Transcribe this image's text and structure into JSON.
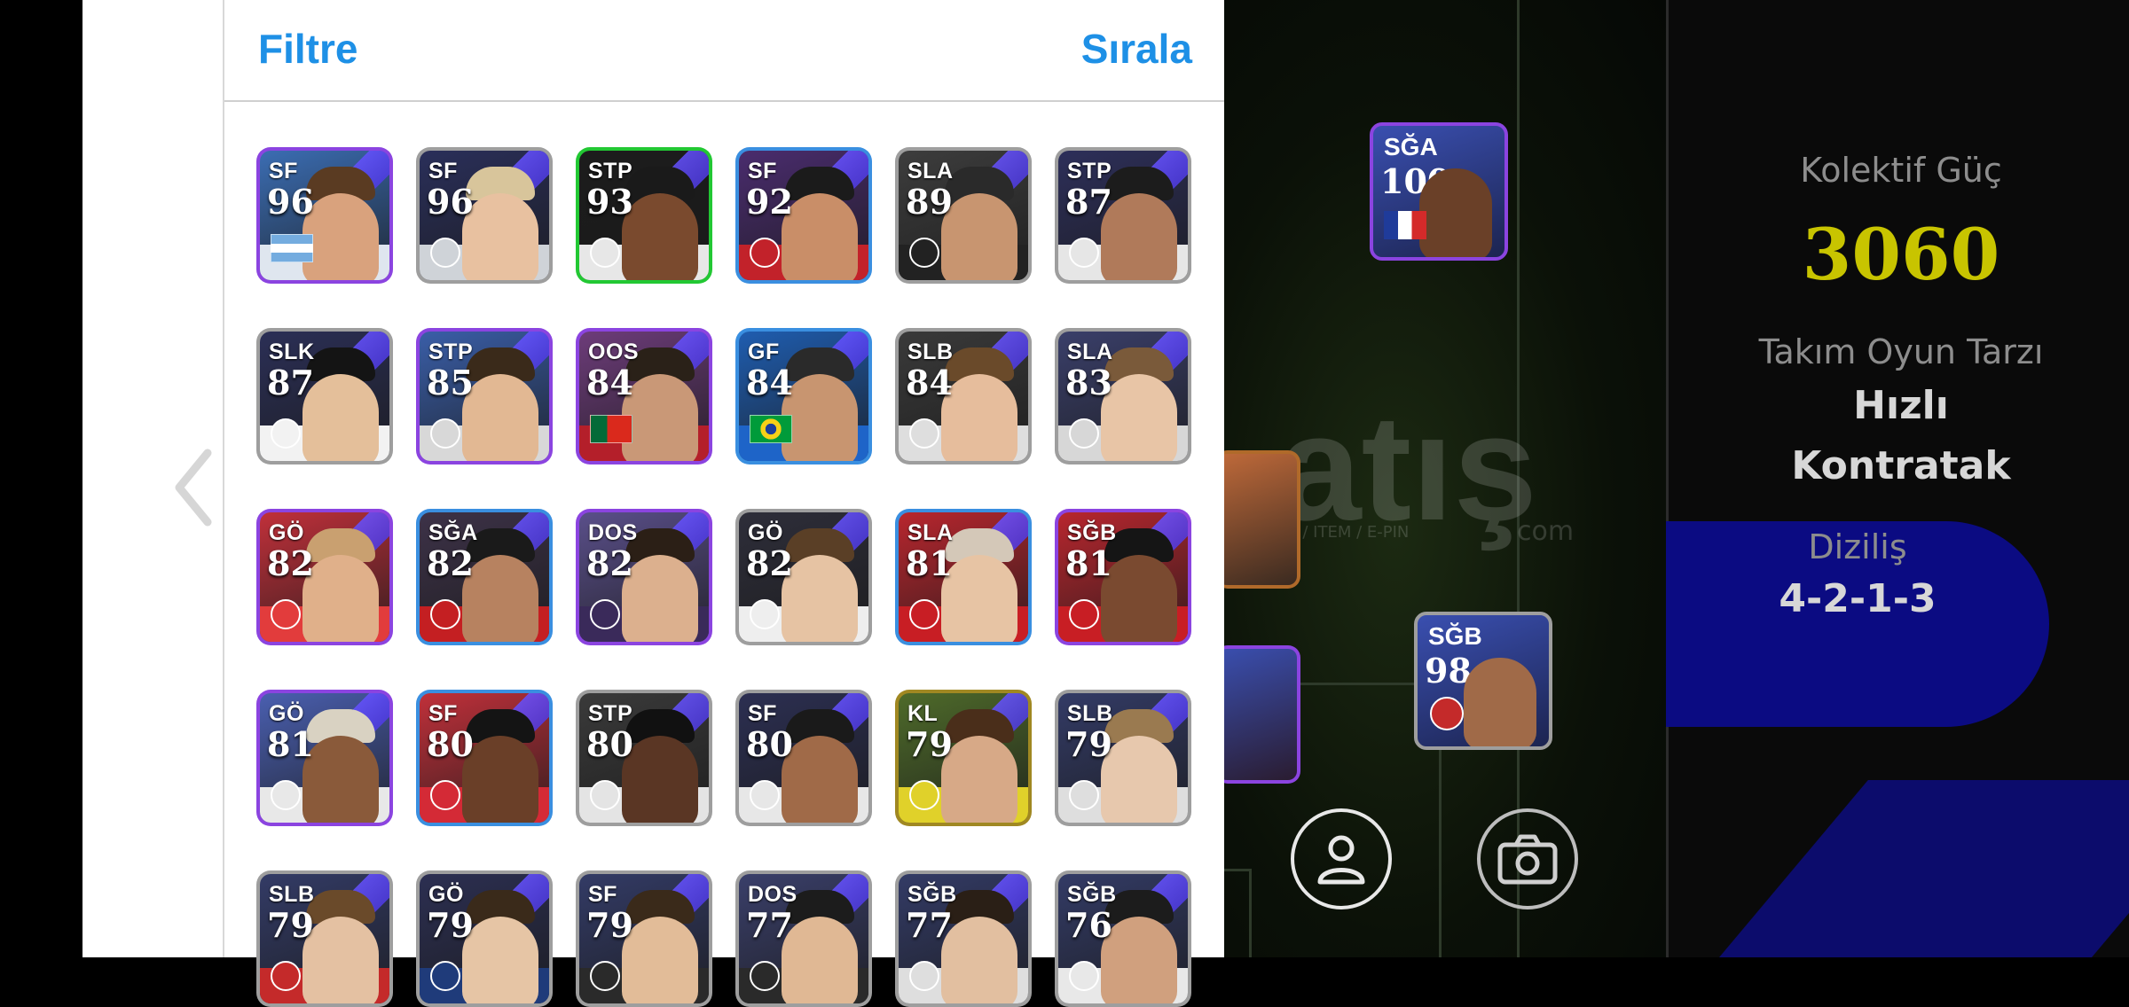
{
  "header": {
    "filter_label": "Filtre",
    "sort_label": "Sırala"
  },
  "team_stats": {
    "collective_label": "Kolektif Güç",
    "collective_value": "3060",
    "playstyle_label": "Takım Oyun Tarzı",
    "playstyle_line1": "Hızlı",
    "playstyle_line2": "Kontratak",
    "formation_label": "Diziliş",
    "formation_value": "4-2-1-3"
  },
  "pitch_players": [
    {
      "position": "SĞA",
      "rating": "100"
    },
    {
      "position": "SĞB",
      "rating": "98"
    }
  ],
  "watermark": {
    "brand": "atış",
    "tagline": "AP / SKIN / ITEM / E-PIN",
    "domain": "com"
  },
  "colors": {
    "accent_blue": "#1e90e6",
    "collective_yellow": "#c8c400",
    "formation_bg": "#0b0b82"
  },
  "players": [
    {
      "position": "SF",
      "rating": "96",
      "frame": "#8b44e0",
      "bg": "#3b6db3",
      "skin": "#d9a27d",
      "hair": "#5a3b22",
      "shirt": "#dfe6ef",
      "marker": "flag-argentina"
    },
    {
      "position": "SF",
      "rating": "96",
      "frame": "#9e9e9e",
      "bg": "#2a2f5a",
      "skin": "#e8c1a0",
      "hair": "#d8c59b",
      "shirt": "#cfd3d8",
      "marker": "badge-club"
    },
    {
      "position": "STP",
      "rating": "93",
      "frame": "#22c833",
      "bg": "#1c1c1c",
      "skin": "#7a4a2e",
      "hair": "#1a1a1a",
      "shirt": "#e7e7e7",
      "marker": "badge-club"
    },
    {
      "position": "SF",
      "rating": "92",
      "frame": "#3a8fe0",
      "bg": "#4a2c6e",
      "skin": "#c98e68",
      "hair": "#1b1b1b",
      "shirt": "#c2222a",
      "marker": "badge-club"
    },
    {
      "position": "SLA",
      "rating": "89",
      "frame": "#9e9e9e",
      "bg": "#3d3d3d",
      "skin": "#c89570",
      "hair": "#2a2a2a",
      "shirt": "#222222",
      "marker": "badge-club"
    },
    {
      "position": "STP",
      "rating": "87",
      "frame": "#9e9e9e",
      "bg": "#2d2f5a",
      "skin": "#b07a5a",
      "hair": "#1c1c1c",
      "shirt": "#e6e6e6",
      "marker": "badge-club"
    },
    {
      "position": "SLK",
      "rating": "87",
      "frame": "#9e9e9e",
      "bg": "#2b2f56",
      "skin": "#e4bf9a",
      "hair": "#141414",
      "shirt": "#f2f2f2",
      "marker": "badge-club"
    },
    {
      "position": "STP",
      "rating": "85",
      "frame": "#8b44e0",
      "bg": "#3a5ea8",
      "skin": "#e2b893",
      "hair": "#3a2a1a",
      "shirt": "#d8d8d8",
      "marker": "badge-club"
    },
    {
      "position": "OOS",
      "rating": "84",
      "frame": "#8b44e0",
      "bg": "#6d3c7a",
      "skin": "#c99877",
      "hair": "#2a2118",
      "shirt": "#b41f2a",
      "marker": "flag-portugal"
    },
    {
      "position": "GF",
      "rating": "84",
      "frame": "#3a8fe0",
      "bg": "#1f5db0",
      "skin": "#c89570",
      "hair": "#2a2a2a",
      "shirt": "#1e64c8",
      "marker": "flag-brazil"
    },
    {
      "position": "SLB",
      "rating": "84",
      "frame": "#9e9e9e",
      "bg": "#3a3a3a",
      "skin": "#e6bd9c",
      "hair": "#6a4a2a",
      "shirt": "#dedede",
      "marker": "badge-club"
    },
    {
      "position": "SLA",
      "rating": "83",
      "frame": "#9e9e9e",
      "bg": "#3a3f6a",
      "skin": "#e8c5a6",
      "hair": "#7a5a3a",
      "shirt": "#d7d7d7",
      "marker": "badge-club"
    },
    {
      "position": "GÖ",
      "rating": "82",
      "frame": "#8b44e0",
      "bg": "#c0303a",
      "skin": "#e0b08a",
      "hair": "#c9a070",
      "shirt": "#e23c3c",
      "marker": "badge-club"
    },
    {
      "position": "SĞA",
      "rating": "82",
      "frame": "#3a8fe0",
      "bg": "#3d3248",
      "skin": "#b78260",
      "hair": "#1a1a1a",
      "shirt": "#c41f22",
      "marker": "badge-club"
    },
    {
      "position": "DOS",
      "rating": "82",
      "frame": "#8b44e0",
      "bg": "#5a4f8a",
      "skin": "#dcb08e",
      "hair": "#2b1f16",
      "shirt": "#3a2a5a",
      "marker": "badge-club"
    },
    {
      "position": "GÖ",
      "rating": "82",
      "frame": "#9e9e9e",
      "bg": "#2e2e3a",
      "skin": "#e6c3a3",
      "hair": "#5a3f26",
      "shirt": "#eeeeee",
      "marker": "badge-club"
    },
    {
      "position": "SLA",
      "rating": "81",
      "frame": "#3a8fe0",
      "bg": "#b8262e",
      "skin": "#e7c4a4",
      "hair": "#d4c8b8",
      "shirt": "#c81e24",
      "marker": "badge-club"
    },
    {
      "position": "SĞB",
      "rating": "81",
      "frame": "#8b44e0",
      "bg": "#b8262e",
      "skin": "#7a4a30",
      "hair": "#151515",
      "shirt": "#c81e24",
      "marker": "badge-club"
    },
    {
      "position": "GÖ",
      "rating": "81",
      "frame": "#8b44e0",
      "bg": "#4a5fb0",
      "skin": "#8a5a3a",
      "hair": "#d9d2c2",
      "shirt": "#e8e8e8",
      "marker": "badge-club"
    },
    {
      "position": "SF",
      "rating": "80",
      "frame": "#3a8fe0",
      "bg": "#c0303a",
      "skin": "#6a3f28",
      "hair": "#141414",
      "shirt": "#d42a36",
      "marker": "badge-club"
    },
    {
      "position": "STP",
      "rating": "80",
      "frame": "#9e9e9e",
      "bg": "#3a3a3a",
      "skin": "#5a3624",
      "hair": "#111111",
      "shirt": "#e4e4e4",
      "marker": "badge-club"
    },
    {
      "position": "SF",
      "rating": "80",
      "frame": "#9e9e9e",
      "bg": "#2c2f52",
      "skin": "#a06a48",
      "hair": "#1a1a1a",
      "shirt": "#e7e7e7",
      "marker": "badge-club"
    },
    {
      "position": "KL",
      "rating": "79",
      "frame": "#a08822",
      "bg": "#4e6a2a",
      "skin": "#d7a987",
      "hair": "#4a2e1a",
      "shirt": "#e0d12a",
      "marker": "badge-club"
    },
    {
      "position": "SLB",
      "rating": "79",
      "frame": "#9e9e9e",
      "bg": "#333b66",
      "skin": "#e7c8ad",
      "hair": "#9a7a50",
      "shirt": "#dedede",
      "marker": "badge-club"
    },
    {
      "position": "SLB",
      "rating": "79",
      "frame": "#9e9e9e",
      "bg": "#333b66",
      "skin": "#e4c1a2",
      "hair": "#6a4a2a",
      "shirt": "#c42a2a",
      "marker": "badge-club"
    },
    {
      "position": "GÖ",
      "rating": "79",
      "frame": "#9e9e9e",
      "bg": "#2c2f52",
      "skin": "#e6c5a5",
      "hair": "#3a2a1a",
      "shirt": "#1f3b7a",
      "marker": "badge-club"
    },
    {
      "position": "SF",
      "rating": "79",
      "frame": "#9e9e9e",
      "bg": "#333b66",
      "skin": "#e2bc98",
      "hair": "#3a2a1a",
      "shirt": "#2a2a2a",
      "marker": "badge-club"
    },
    {
      "position": "DOS",
      "rating": "77",
      "frame": "#9e9e9e",
      "bg": "#3a3f6a",
      "skin": "#e0b894",
      "hair": "#1c1c1c",
      "shirt": "#2a2a2a",
      "marker": "badge-club"
    },
    {
      "position": "SĞB",
      "rating": "77",
      "frame": "#9e9e9e",
      "bg": "#333b66",
      "skin": "#e2bfa0",
      "hair": "#2a1f16",
      "shirt": "#dedede",
      "marker": "badge-club"
    },
    {
      "position": "SĞB",
      "rating": "76",
      "frame": "#9e9e9e",
      "bg": "#333b66",
      "skin": "#d0a07e",
      "hair": "#1c1c1c",
      "shirt": "#e8e8e8",
      "marker": "badge-club"
    }
  ]
}
